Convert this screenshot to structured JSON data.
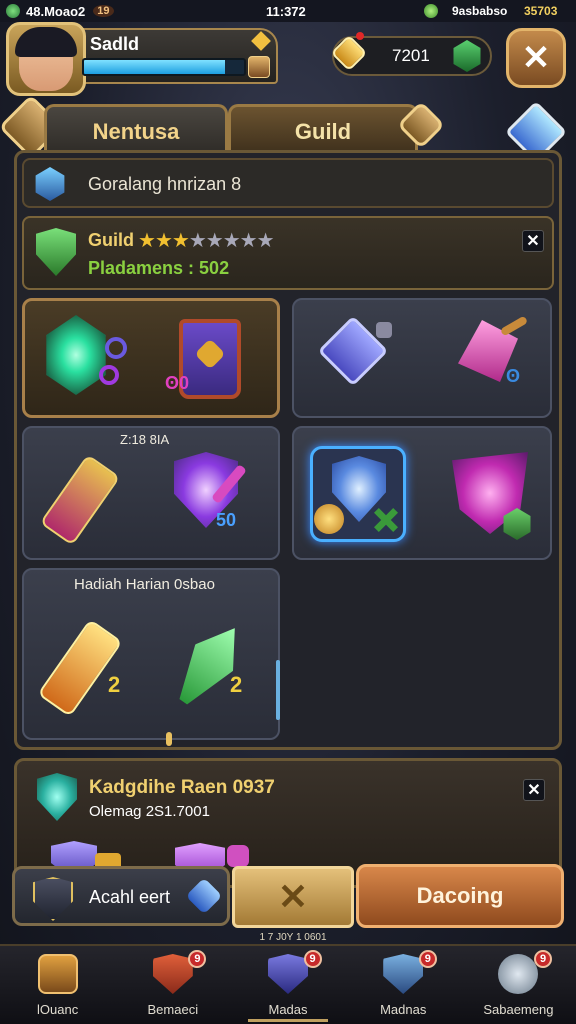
{
  "status_bar": {
    "left_text": "48.Moao2",
    "left_badge": "19",
    "time": "11:372",
    "right_text": "9asbabso",
    "right_value": "35703"
  },
  "header": {
    "player_name": "Sadld",
    "xp_progress": 0.88,
    "resource_value": "7201",
    "close_label": "✕"
  },
  "tabs": [
    {
      "label": "Nentusa",
      "selected": false
    },
    {
      "label": "Guild",
      "selected": true
    }
  ],
  "info_row": {
    "text": "Goralang hnrizan 8"
  },
  "guild_row": {
    "name": "Guild",
    "stars_filled": 3,
    "stars_total": 8,
    "subtitle": "Pladamens : 502",
    "close_label": "✕"
  },
  "item_cards": [
    {
      "id": "card-1",
      "selected": true,
      "caption": "",
      "items": [
        {
          "icon": "emerald-gem-icon",
          "badge": ""
        },
        {
          "icon": "royal-banner-icon",
          "badge": ""
        }
      ]
    },
    {
      "id": "card-2",
      "selected": false,
      "caption": "",
      "items": [
        {
          "icon": "blue-potion-icon",
          "badge": ""
        },
        {
          "icon": "pink-axe-icon",
          "badge": ""
        }
      ]
    },
    {
      "id": "card-3",
      "selected": false,
      "caption": "Z:18 8IA",
      "items": [
        {
          "icon": "red-crystal-sword-icon",
          "badge": ""
        },
        {
          "icon": "purple-shield-icon",
          "badge": "50"
        }
      ]
    },
    {
      "id": "card-4",
      "selected": false,
      "caption": "",
      "items": [
        {
          "icon": "blue-crystal-shield-icon",
          "badge": ""
        },
        {
          "icon": "magenta-crystal-shield-icon",
          "badge": ""
        }
      ]
    },
    {
      "id": "card-5",
      "selected": false,
      "caption": "Hadiah Harian  0sbao",
      "items": [
        {
          "icon": "golden-sword-icon",
          "badge": "2"
        },
        {
          "icon": "green-crystal-sword-icon",
          "badge": "2"
        }
      ]
    }
  ],
  "lower_panel": {
    "title": "Kadgdihe Raen  0937",
    "subtitle": "Olemag 2S1.7001",
    "close_label": "✕"
  },
  "action_bar": {
    "left_label": "Acahl eert",
    "mid_label": "✕",
    "right_label": "Dacoing",
    "sub_text": "1 7 J0Y 1 0601"
  },
  "bottom_nav": [
    {
      "label": "lOuanc",
      "icon": "treasure-chest-icon",
      "badge": ""
    },
    {
      "label": "Bemaeci",
      "icon": "trophy-shield-icon",
      "badge": "9"
    },
    {
      "label": "Madas",
      "icon": "purple-crest-icon",
      "badge": "9"
    },
    {
      "label": "Madnas",
      "icon": "blue-crest-icon",
      "badge": "9"
    },
    {
      "label": "Sabaemeng",
      "icon": "settings-orb-icon",
      "badge": "9"
    }
  ],
  "colors": {
    "accent_gold": "#e2c27a",
    "xp_blue": "#1d9fe0",
    "guild_green": "#4ad060",
    "action_orange": "#c8743a"
  }
}
